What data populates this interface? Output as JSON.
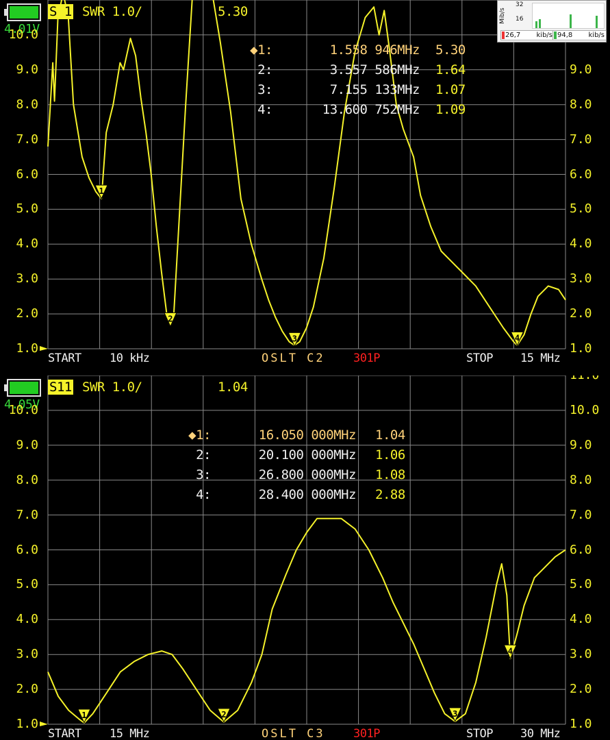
{
  "colors": {
    "trace": "#f5f22a",
    "grid": "#8a8a8a",
    "background": "#000000",
    "battery": "#22cc22"
  },
  "top": {
    "voltage": "4.01V",
    "trace_tag": "S 1",
    "format": "SWR 1.0/",
    "active_value": "5.30",
    "markers": [
      {
        "label": "◆1:",
        "freq": "1.558 946MHz",
        "swr": "5.30"
      },
      {
        "label": "2:",
        "freq": "3.557 586MHz",
        "swr": "1.64"
      },
      {
        "label": "3:",
        "freq": "7.155 133MHz",
        "swr": "1.07"
      },
      {
        "label": "4:",
        "freq": "13.600 752MHz",
        "swr": "1.09"
      }
    ],
    "footer": {
      "start": "START",
      "start_freq": "10 kHz",
      "cal": "OSLT C2",
      "points": "301P",
      "stop": "STOP",
      "stop_freq": "15 MHz"
    },
    "y_labels": [
      "10.0",
      "9.0",
      "8.0",
      "7.0",
      "6.0",
      "5.0",
      "4.0",
      "3.0",
      "2.0",
      "1.0"
    ],
    "y_labels_right": [
      "9.0",
      "8.0",
      "7.0",
      "6.0",
      "5.0",
      "4.0",
      "3.0",
      "2.0",
      "1.0"
    ]
  },
  "bottom": {
    "voltage": "4.05V",
    "trace_tag": "S11",
    "format": "SWR 1.0/",
    "active_value": "1.04",
    "markers": [
      {
        "label": "◆1:",
        "freq": "16.050 000MHz",
        "swr": "1.04"
      },
      {
        "label": "2:",
        "freq": "20.100 000MHz",
        "swr": "1.06"
      },
      {
        "label": "3:",
        "freq": "26.800 000MHz",
        "swr": "1.08"
      },
      {
        "label": "4:",
        "freq": "28.400 000MHz",
        "swr": "2.88"
      }
    ],
    "footer": {
      "start": "START",
      "start_freq": "15 MHz",
      "cal": "OSLT C3",
      "points": "301P",
      "stop": "STOP",
      "stop_freq": "30 MHz"
    },
    "y_labels": [
      "10.0",
      "9.0",
      "8.0",
      "7.0",
      "6.0",
      "5.0",
      "4.0",
      "3.0",
      "2.0",
      "1.0"
    ],
    "y_labels_right": [
      "11.0",
      "10.0",
      "9.0",
      "8.0",
      "7.0",
      "6.0",
      "5.0",
      "4.0",
      "3.0",
      "2.0",
      "1.0"
    ]
  },
  "network_widget": {
    "unit": "Mib/s",
    "scale_max": "32",
    "scale_mid": "16",
    "download": "26,7",
    "download_unit": "kib/s",
    "upload": "94,8",
    "upload_unit": "kib/s"
  },
  "chart_data": [
    {
      "type": "line",
      "name_hint": "top",
      "xlabel": "",
      "ylabel": "",
      "x_range_mhz": [
        0.01,
        15
      ],
      "ylim": [
        1,
        10
      ],
      "grid": true,
      "x": [
        0.01,
        0.15,
        0.2,
        0.3,
        0.45,
        0.6,
        0.75,
        1.0,
        1.2,
        1.4,
        1.56,
        1.7,
        1.9,
        2.1,
        2.2,
        2.4,
        2.55,
        2.7,
        2.85,
        3.0,
        3.15,
        3.3,
        3.45,
        3.56,
        3.65,
        3.8,
        4.0,
        4.2,
        4.4,
        4.6,
        4.8,
        5.0,
        5.3,
        5.6,
        5.9,
        6.2,
        6.4,
        6.6,
        6.8,
        7.0,
        7.15,
        7.3,
        7.5,
        7.7,
        8.0,
        8.3,
        8.6,
        8.9,
        9.2,
        9.45,
        9.6,
        9.75,
        9.9,
        10.1,
        10.3,
        10.6,
        10.8,
        11.1,
        11.4,
        11.7,
        12.0,
        12.4,
        12.8,
        13.2,
        13.5,
        13.6,
        13.8,
        14.0,
        14.2,
        14.5,
        14.8,
        15.0
      ],
      "values": [
        6.8,
        9.2,
        8.1,
        10.5,
        11.5,
        10.5,
        8.0,
        6.5,
        5.9,
        5.5,
        5.3,
        7.2,
        8.0,
        9.2,
        9.0,
        9.9,
        9.4,
        8.2,
        7.2,
        6.0,
        4.5,
        3.2,
        2.0,
        1.7,
        1.9,
        4.5,
        8.0,
        11.5,
        12.0,
        12.0,
        11.0,
        9.8,
        7.8,
        5.3,
        4.0,
        3.0,
        2.4,
        1.9,
        1.5,
        1.2,
        1.1,
        1.2,
        1.6,
        2.2,
        3.6,
        5.6,
        7.8,
        9.5,
        10.5,
        10.8,
        10.0,
        10.7,
        9.6,
        8.0,
        7.3,
        6.5,
        5.4,
        4.5,
        3.8,
        3.5,
        3.2,
        2.8,
        2.2,
        1.6,
        1.2,
        1.1,
        1.4,
        2.0,
        2.5,
        2.8,
        2.7,
        2.4
      ],
      "markers": [
        {
          "id": 1,
          "x": 1.558946,
          "y": 5.3
        },
        {
          "id": 2,
          "x": 3.557586,
          "y": 1.64
        },
        {
          "id": 3,
          "x": 7.155133,
          "y": 1.07
        },
        {
          "id": 4,
          "x": 13.600752,
          "y": 1.09
        }
      ]
    },
    {
      "type": "line",
      "name_hint": "bottom",
      "xlabel": "",
      "ylabel": "",
      "x_range_mhz": [
        15,
        30
      ],
      "ylim": [
        1,
        10
      ],
      "grid": true,
      "x": [
        15.0,
        15.3,
        15.6,
        15.9,
        16.05,
        16.3,
        16.7,
        17.1,
        17.5,
        17.9,
        18.3,
        18.6,
        18.9,
        19.3,
        19.7,
        20.1,
        20.5,
        20.9,
        21.2,
        21.5,
        21.9,
        22.2,
        22.5,
        22.8,
        23.1,
        23.5,
        23.9,
        24.3,
        24.7,
        25.0,
        25.3,
        25.6,
        25.9,
        26.2,
        26.5,
        26.8,
        27.1,
        27.4,
        27.7,
        28.0,
        28.15,
        28.3,
        28.4,
        28.6,
        28.8,
        29.1,
        29.4,
        29.7,
        30.0
      ],
      "values": [
        2.5,
        1.8,
        1.4,
        1.15,
        1.04,
        1.3,
        1.9,
        2.5,
        2.8,
        3.0,
        3.1,
        3.0,
        2.6,
        2.0,
        1.4,
        1.06,
        1.4,
        2.2,
        3.0,
        4.3,
        5.3,
        6.0,
        6.5,
        6.9,
        6.9,
        6.9,
        6.6,
        6.0,
        5.2,
        4.5,
        3.9,
        3.3,
        2.6,
        1.9,
        1.3,
        1.08,
        1.3,
        2.2,
        3.5,
        5.0,
        5.6,
        4.7,
        2.88,
        3.6,
        4.4,
        5.2,
        5.5,
        5.8,
        6.0
      ],
      "markers": [
        {
          "id": 1,
          "x": 16.05,
          "y": 1.04
        },
        {
          "id": 2,
          "x": 20.1,
          "y": 1.06
        },
        {
          "id": 3,
          "x": 26.8,
          "y": 1.08
        },
        {
          "id": 4,
          "x": 28.4,
          "y": 2.88
        }
      ]
    }
  ]
}
